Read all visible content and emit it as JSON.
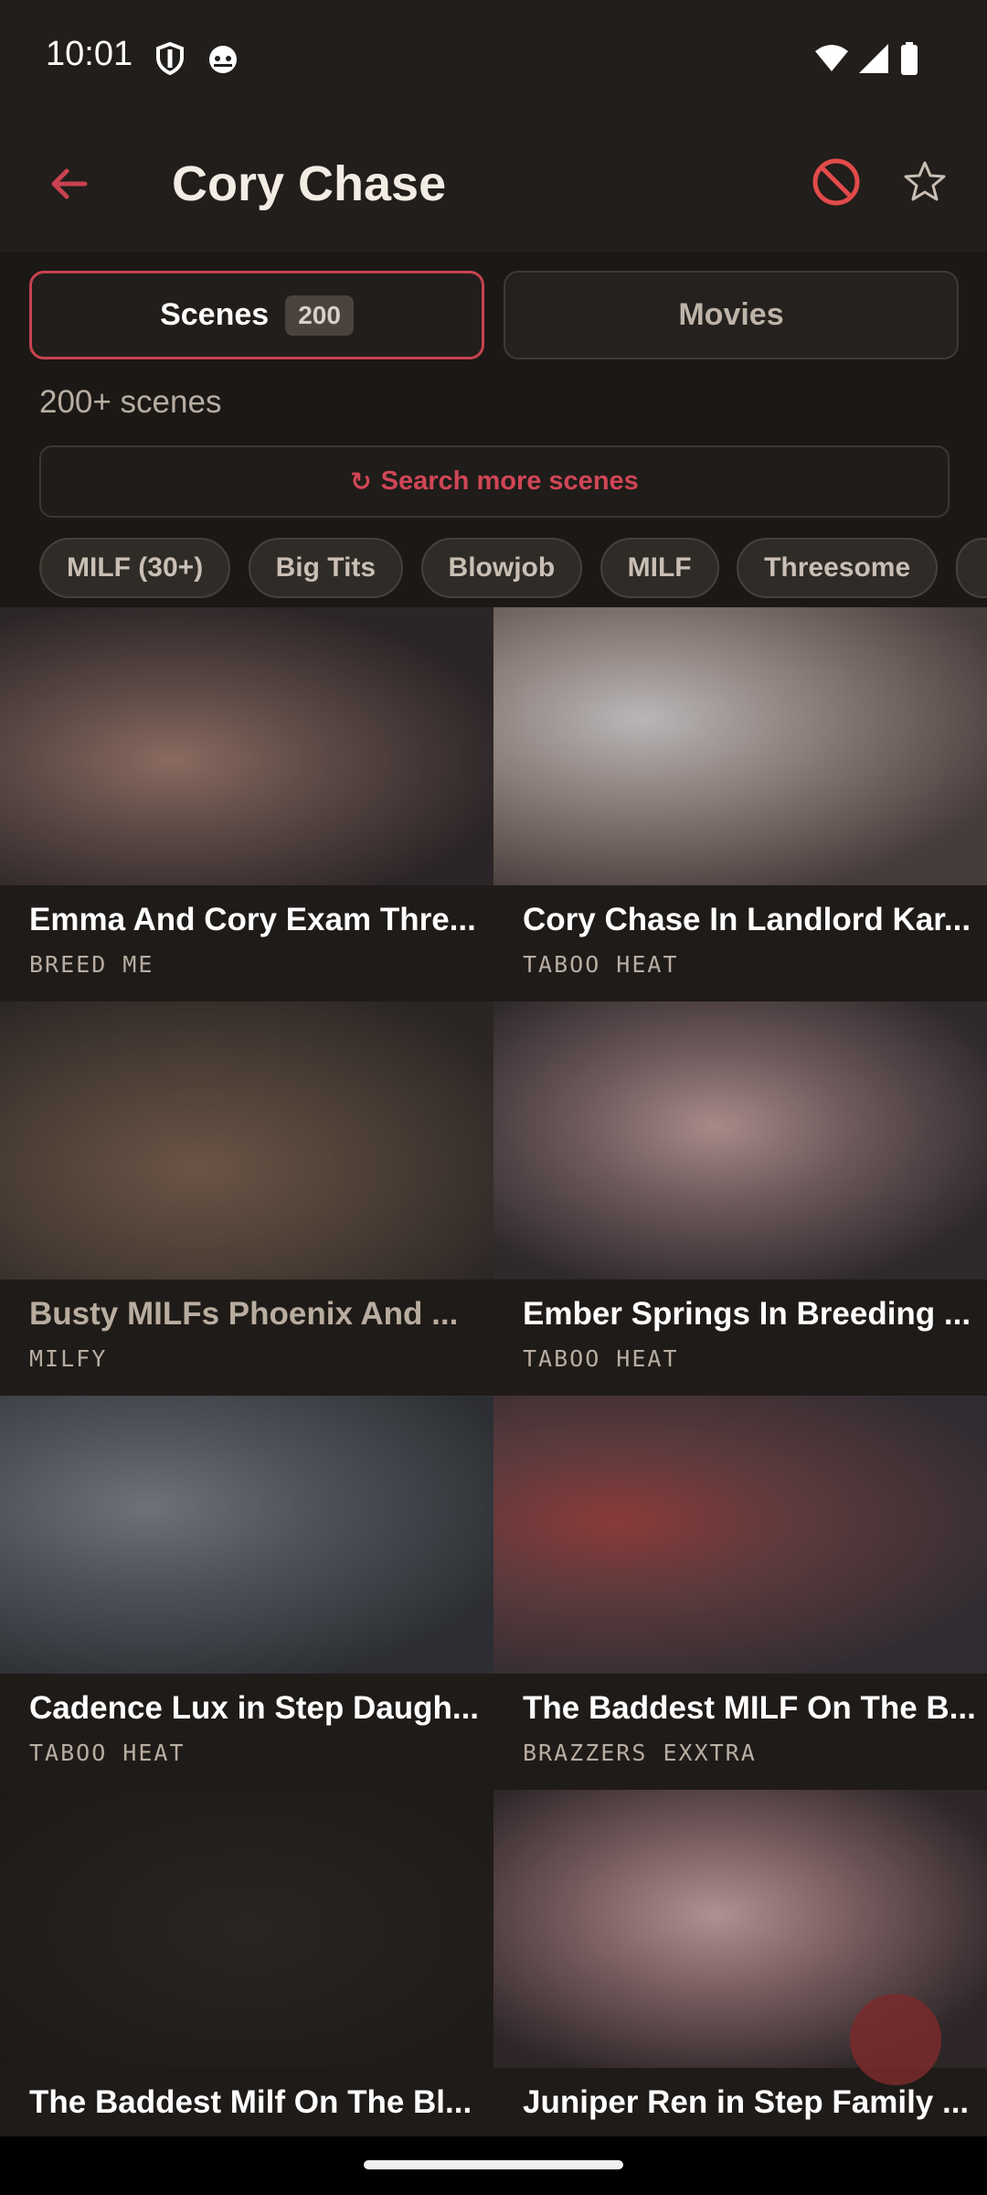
{
  "status_bar": {
    "time": "10:01",
    "icons": [
      "shield-icon",
      "cat-icon",
      "wifi-icon",
      "signal-icon",
      "battery-icon"
    ]
  },
  "app_bar": {
    "title": "Cory Chase",
    "back_icon": "arrow-back-icon",
    "block_icon": "block-icon",
    "favorite_icon": "star-outline-icon"
  },
  "tabs": {
    "scenes_label": "Scenes",
    "scenes_count": "200",
    "movies_label": "Movies"
  },
  "scene_count_text": "200+ scenes",
  "search_more": {
    "icon": "↻",
    "label": "Search more scenes"
  },
  "chips": [
    "MILF (30+)",
    "Big Tits",
    "Blowjob",
    "MILF",
    "Threesome",
    ""
  ],
  "scenes": [
    {
      "title": "Emma And Cory Exam Thre...",
      "studio": "BREED ME"
    },
    {
      "title": "Cory Chase In Landlord Kar...",
      "studio": "TABOO HEAT"
    },
    {
      "title": "Busty MILFs Phoenix And ...",
      "studio": "MILFY"
    },
    {
      "title": "Ember Springs In Breeding ...",
      "studio": "TABOO HEAT"
    },
    {
      "title": "Cadence Lux in Step Daugh...",
      "studio": "TABOO HEAT"
    },
    {
      "title": "The Baddest MILF On The B...",
      "studio": "BRAZZERS EXXTRA"
    },
    {
      "title": "The Baddest Milf On The Bl...",
      "studio": ""
    },
    {
      "title": "Juniper Ren in Step Family ...",
      "studio": ""
    }
  ],
  "colors": {
    "accent": "#c8424f",
    "background": "#1b1815",
    "bar": "#211e1b"
  }
}
